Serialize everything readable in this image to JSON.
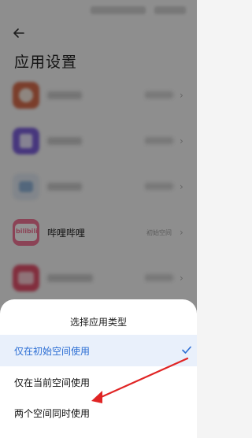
{
  "page_title": "应用设置",
  "apps": [
    {
      "name": null,
      "value": null,
      "icon": "blurred-app-icon",
      "color": "#d46b4b"
    },
    {
      "name": null,
      "value": null,
      "icon": "blurred-app-icon",
      "color": "#7b5fd8"
    },
    {
      "name": null,
      "value": null,
      "icon": "blurred-app-icon",
      "color": "#8fb2d6"
    },
    {
      "name": "哔哩哔哩",
      "value": "初始空间",
      "icon": "bilibili-icon",
      "color": "#f07494"
    },
    {
      "name": null,
      "value": null,
      "icon": "blurred-app-icon",
      "color": "#e0506a"
    },
    {
      "name": null,
      "value": null,
      "icon": "blurred-app-icon",
      "color": "#e0724e"
    }
  ],
  "sheet": {
    "title": "选择应用类型",
    "options": [
      {
        "label": "仅在初始空间使用",
        "selected": true
      },
      {
        "label": "仅在当前空间使用",
        "selected": false
      },
      {
        "label": "两个空间同时使用",
        "selected": false
      }
    ]
  },
  "bilibili_icon_text": "bilibili",
  "colors": {
    "accent": "#2c6ed4",
    "annotation_arrow": "#e02424",
    "bilibili": "#f07494"
  }
}
